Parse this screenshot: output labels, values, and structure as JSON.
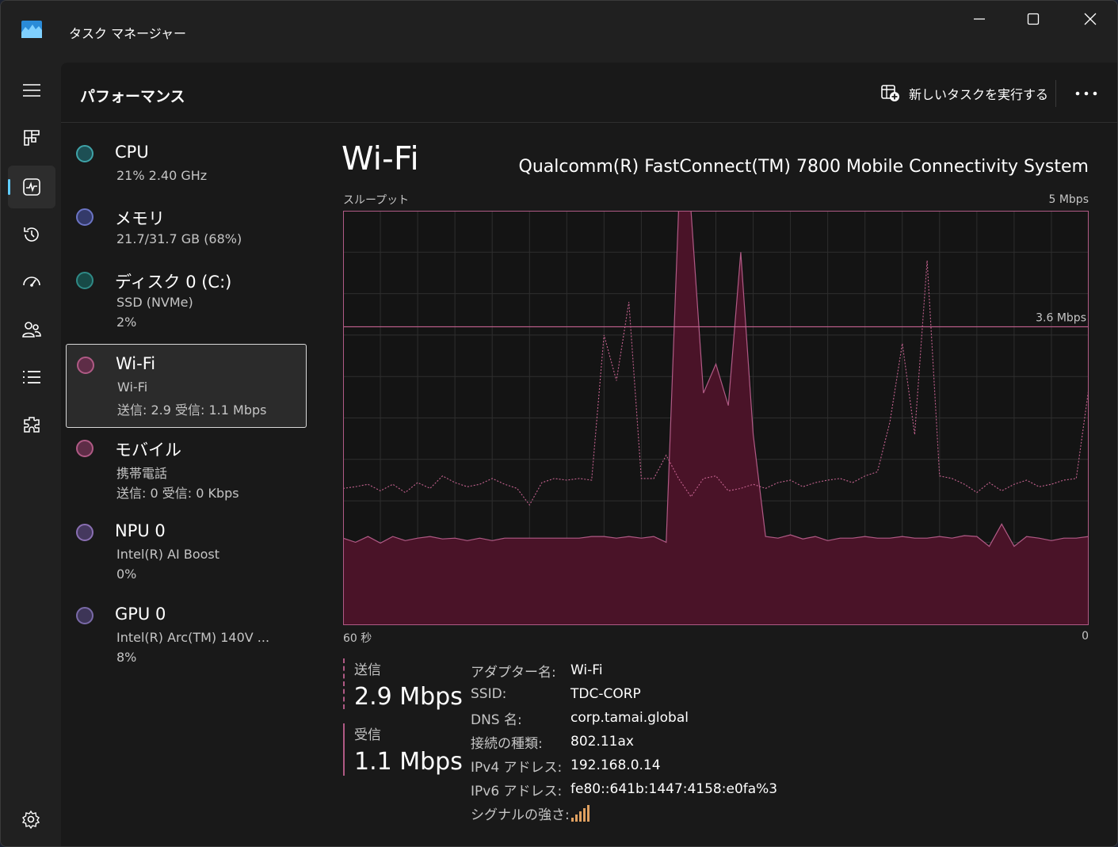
{
  "window": {
    "title": "タスク マネージャー"
  },
  "colors": {
    "accent": "#60cdff",
    "wifi": "#b05a85",
    "cpu": "#3fa3a8",
    "memory": "#6b74c4",
    "disk": "#2f8a86",
    "npu": "#8a6fb3",
    "gpu": "#7a6aa8"
  },
  "nav": [
    {
      "icon": "hamburger-menu-icon"
    },
    {
      "icon": "processes-icon"
    },
    {
      "icon": "performance-icon"
    },
    {
      "icon": "app-history-icon"
    },
    {
      "icon": "startup-apps-icon"
    },
    {
      "icon": "users-icon"
    },
    {
      "icon": "details-icon"
    },
    {
      "icon": "services-icon"
    },
    {
      "icon": "settings-icon"
    }
  ],
  "header": {
    "title": "パフォーマンス",
    "run_task": "新しいタスクを実行する"
  },
  "sidebar": {
    "items": [
      {
        "name": "CPU",
        "sub1": "21%  2.40 GHz",
        "sub2": ""
      },
      {
        "name": "メモリ",
        "sub1": "21.7/31.7 GB (68%)",
        "sub2": ""
      },
      {
        "name": "ディスク 0 (C:)",
        "sub1": "SSD (NVMe)",
        "sub2": "2%"
      },
      {
        "name": "Wi-Fi",
        "sub1": "Wi-Fi",
        "sub2": "送信: 2.9  受信: 1.1 Mbps"
      },
      {
        "name": "モバイル",
        "sub1": "携帯電話",
        "sub2": "送信: 0  受信: 0 Kbps"
      },
      {
        "name": "NPU 0",
        "sub1": "Intel(R) AI Boost",
        "sub2": "0%"
      },
      {
        "name": "GPU 0",
        "sub1": "Intel(R) Arc(TM) 140V ...",
        "sub2": "8%"
      }
    ]
  },
  "main": {
    "title": "Wi-Fi",
    "adapter_desc": "Qualcomm(R) FastConnect(TM) 7800 Mobile Connectivity System",
    "throughput_label": "スループット",
    "ymax_label": "5 Mbps",
    "ref_label": "3.6 Mbps",
    "x_left_label": "60 秒",
    "x_right_label": "0",
    "send_label": "送信",
    "send_value": "2.9 Mbps",
    "recv_label": "受信",
    "recv_value": "1.1 Mbps",
    "details": [
      {
        "label": "アダプター名:",
        "value": "Wi-Fi"
      },
      {
        "label": "SSID:",
        "value": "TDC-CORP"
      },
      {
        "label": "DNS 名:",
        "value": "corp.tamai.global"
      },
      {
        "label": "接続の種類:",
        "value": "802.11ax"
      },
      {
        "label": "IPv4 アドレス:",
        "value": "192.168.0.14"
      },
      {
        "label": "IPv6 アドレス:",
        "value": "fe80::641b:1447:4158:e0fa%3"
      },
      {
        "label": "シグナルの強さ:",
        "value": ""
      }
    ],
    "signal_icon": "signal-strength-icon"
  },
  "chart_data": {
    "type": "area",
    "title": "",
    "xlabel": "",
    "ylabel": "",
    "xlim": [
      60,
      0
    ],
    "ylim": [
      0,
      5
    ],
    "grid": true,
    "reference_line": 3.6,
    "x": [
      60,
      59,
      58,
      57,
      56,
      55,
      54,
      53,
      52,
      51,
      50,
      49,
      48,
      47,
      46,
      45,
      44,
      43,
      42,
      41,
      40,
      39,
      38,
      37,
      36,
      35,
      34,
      33,
      32,
      31,
      30,
      29,
      28,
      27,
      26,
      25,
      24,
      23,
      22,
      21,
      20,
      19,
      18,
      17,
      16,
      15,
      14,
      13,
      12,
      11,
      10,
      9,
      8,
      7,
      6,
      5,
      4,
      3,
      2,
      1,
      0
    ],
    "series": [
      {
        "name": "送信",
        "style": "dashed",
        "values": [
          1.65,
          1.67,
          1.7,
          1.62,
          1.7,
          1.6,
          1.72,
          1.65,
          1.8,
          1.72,
          1.67,
          1.7,
          1.77,
          1.7,
          1.65,
          1.45,
          1.72,
          1.77,
          1.75,
          1.77,
          1.75,
          3.5,
          2.95,
          3.9,
          1.77,
          1.77,
          2.05,
          1.77,
          1.55,
          1.77,
          1.8,
          1.62,
          1.65,
          1.7,
          1.65,
          1.72,
          1.75,
          1.67,
          1.72,
          1.75,
          1.77,
          1.72,
          1.8,
          1.85,
          2.45,
          3.4,
          2.3,
          4.4,
          1.8,
          1.77,
          1.7,
          1.6,
          1.72,
          1.62,
          1.7,
          1.75,
          1.67,
          1.7,
          1.75,
          1.77,
          2.85
        ]
      },
      {
        "name": "受信",
        "style": "solid",
        "values": [
          1.05,
          1.0,
          1.07,
          0.99,
          1.07,
          1.02,
          1.05,
          1.07,
          1.04,
          1.05,
          1.02,
          1.05,
          1.02,
          1.05,
          1.05,
          1.05,
          1.05,
          1.05,
          1.05,
          1.05,
          1.07,
          1.07,
          1.05,
          1.07,
          1.05,
          1.07,
          1.0,
          5.0,
          5.0,
          2.8,
          3.15,
          2.65,
          4.5,
          2.3,
          1.07,
          1.05,
          1.09,
          1.04,
          1.07,
          1.02,
          1.05,
          1.05,
          1.07,
          1.05,
          1.05,
          1.07,
          1.05,
          1.05,
          1.07,
          1.05,
          1.08,
          1.07,
          0.95,
          1.22,
          0.95,
          1.07,
          1.05,
          1.02,
          1.05,
          1.05,
          1.07
        ]
      }
    ]
  }
}
